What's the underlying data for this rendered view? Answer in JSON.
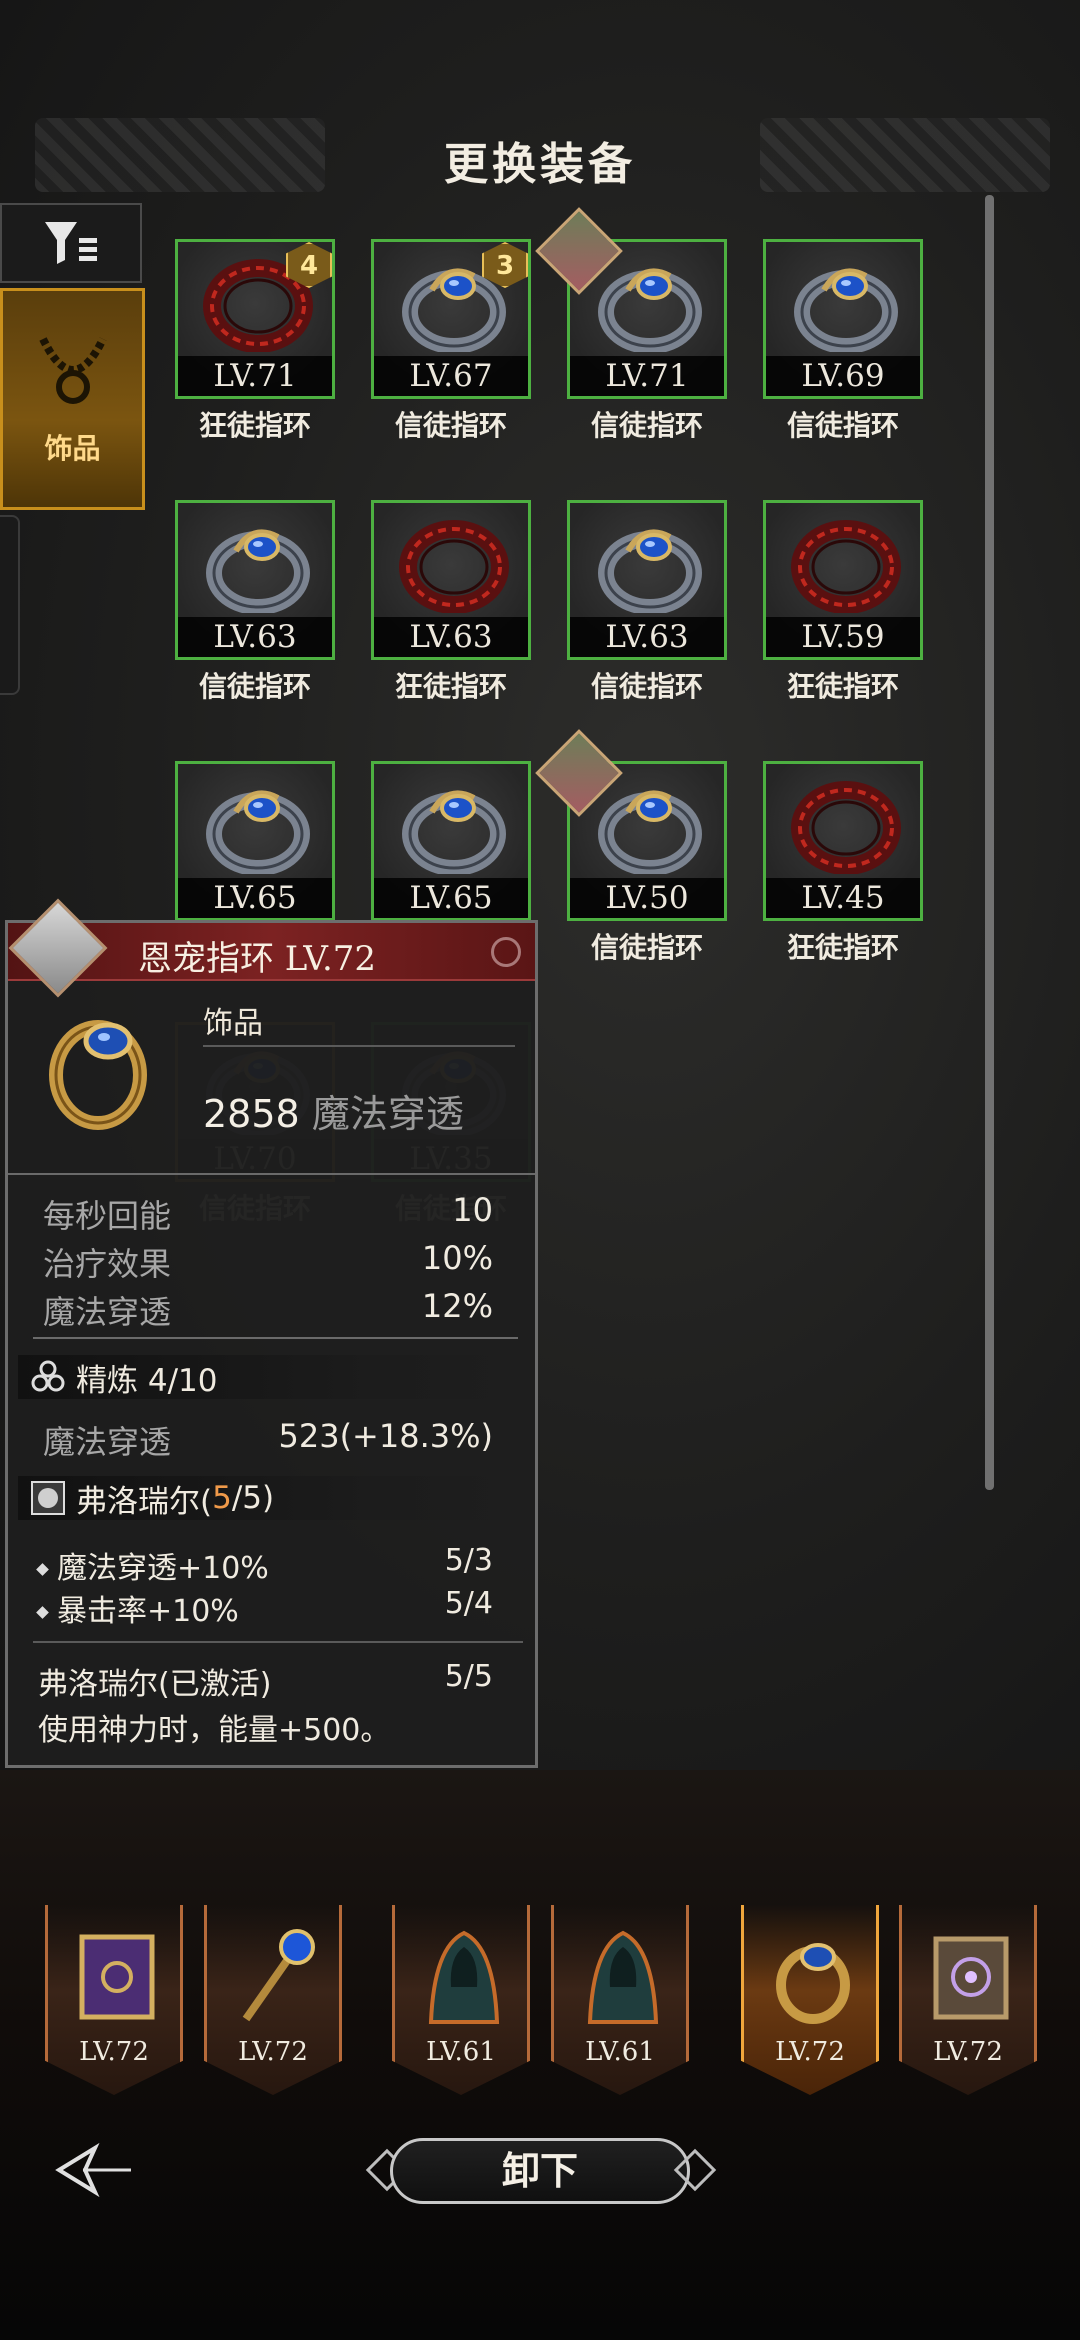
{
  "title": "更换装备",
  "side_tabs": {
    "filter_icon": "filter-icon",
    "accessory_label": "饰品"
  },
  "items": [
    {
      "level": "LV.71",
      "name": "狂徒指环",
      "type": "red",
      "badge": "4"
    },
    {
      "level": "LV.67",
      "name": "信徒指环",
      "type": "blue",
      "badge": "3"
    },
    {
      "level": "LV.71",
      "name": "信徒指环",
      "type": "blue",
      "hero": true
    },
    {
      "level": "LV.69",
      "name": "信徒指环",
      "type": "blue"
    },
    {
      "level": "LV.63",
      "name": "信徒指环",
      "type": "blue"
    },
    {
      "level": "LV.63",
      "name": "狂徒指环",
      "type": "red"
    },
    {
      "level": "LV.63",
      "name": "信徒指环",
      "type": "blue"
    },
    {
      "level": "LV.59",
      "name": "狂徒指环",
      "type": "red"
    },
    {
      "level": "LV.65",
      "name": "",
      "type": "blue"
    },
    {
      "level": "LV.65",
      "name": "",
      "type": "blue"
    },
    {
      "level": "LV.50",
      "name": "信徒指环",
      "type": "blue",
      "hero": true
    },
    {
      "level": "LV.45",
      "name": "狂徒指环",
      "type": "red"
    },
    {
      "level": "LV.70",
      "name": "信徒指环",
      "type": "blue",
      "selected": true
    },
    {
      "level": "LV.35",
      "name": "信徒指环",
      "type": "blue"
    }
  ],
  "detail": {
    "title": "恩宠指环 LV.72",
    "category": "饰品",
    "main_value": "2858",
    "main_stat": "魔法穿透",
    "stats": [
      {
        "label": "每秒回能",
        "value": "10"
      },
      {
        "label": "治疗效果",
        "value": "10%"
      },
      {
        "label": "魔法穿透",
        "value": "12%"
      }
    ],
    "refine_label": "精炼 4/10",
    "refine_stat": {
      "label": "魔法穿透",
      "value": "523(+18.3%)"
    },
    "set_name": "弗洛瑞尔(",
    "set_count": "5",
    "set_total": "/5)",
    "set_effects": [
      {
        "label": "魔法穿透+10%",
        "value": "5/3"
      },
      {
        "label": "暴击率+10%",
        "value": "5/4"
      }
    ],
    "set_active": {
      "label": "弗洛瑞尔(已激活)",
      "value": "5/5"
    },
    "set_active_desc": "使用神力时，能量+500。"
  },
  "equipped": [
    {
      "level": "LV.72",
      "art": "tome"
    },
    {
      "level": "LV.72",
      "art": "staff"
    },
    {
      "level": "LV.61",
      "art": "cloak"
    },
    {
      "level": "LV.61",
      "art": "cloak"
    },
    {
      "level": "LV.72",
      "art": "ring",
      "selected": true
    },
    {
      "level": "LV.72",
      "art": "grimoire"
    }
  ],
  "unequip_label": "卸下",
  "colors": {
    "green_border": "#4db041",
    "gold_border": "#e1a130",
    "set_count": "#f09a4a"
  }
}
